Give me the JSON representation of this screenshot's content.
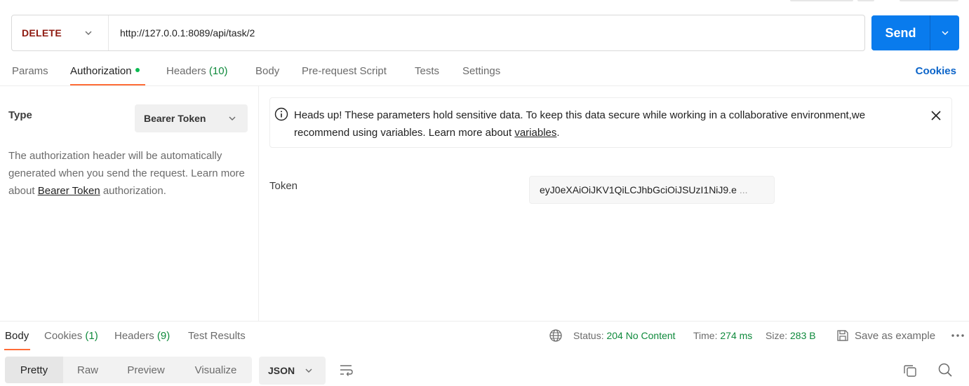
{
  "request": {
    "method": "DELETE",
    "url": "http://127.0.0.1:8089/api/task/2",
    "send_label": "Send"
  },
  "request_tabs": {
    "params": "Params",
    "authorization": "Authorization",
    "headers": "Headers",
    "headers_count": "(10)",
    "body": "Body",
    "pre_request_script": "Pre-request Script",
    "tests": "Tests",
    "settings": "Settings",
    "cookies": "Cookies"
  },
  "auth": {
    "type_label": "Type",
    "type_value": "Bearer Token",
    "desc_prefix": "The authorization header will be automatically generated when you send the request. Learn more about ",
    "desc_link": "Bearer Token",
    "desc_suffix": " authorization.",
    "notice_prefix": "Heads up! These parameters hold sensitive data. To keep this data secure while working in a collaborative environment,we recommend using variables. Learn more about ",
    "notice_link": "variables",
    "notice_suffix": ".",
    "token_label": "Token",
    "token_value": "eyJ0eXAiOiJKV1QiLCJhbGciOiJSUzI1NiJ9.e",
    "token_ellipsis": "..."
  },
  "response_tabs": {
    "body": "Body",
    "cookies": "Cookies",
    "cookies_count": "(1)",
    "headers": "Headers",
    "headers_count": "(9)",
    "test_results": "Test Results"
  },
  "response_meta": {
    "status_label": "Status:",
    "status_value": "204 No Content",
    "time_label": "Time:",
    "time_value": "274 ms",
    "size_label": "Size:",
    "size_value": "283 B",
    "save_example": "Save as example"
  },
  "response_toolbar": {
    "views": [
      "Pretty",
      "Raw",
      "Preview",
      "Visualize"
    ],
    "active_view": "Pretty",
    "format": "JSON"
  },
  "colors": {
    "accent": "#ff6c37",
    "send": "#097bed",
    "method_delete": "#8e1a10",
    "success": "#0f8a3c",
    "link": "#0b64c9"
  }
}
